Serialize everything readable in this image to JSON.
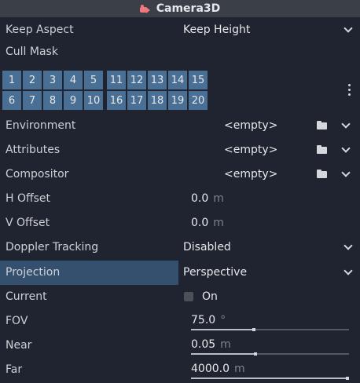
{
  "header": {
    "title": "Camera3D",
    "icon": "camera3d-icon"
  },
  "properties": {
    "keep_aspect": {
      "label": "Keep Aspect",
      "value": "Keep Height"
    },
    "cull_mask": {
      "label": "Cull Mask",
      "layers_row1": [
        "1",
        "2",
        "3",
        "4",
        "5",
        "11",
        "12",
        "13",
        "14",
        "15"
      ],
      "layers_row2": [
        "6",
        "7",
        "8",
        "9",
        "10",
        "16",
        "17",
        "18",
        "19",
        "20"
      ]
    },
    "environment": {
      "label": "Environment",
      "value": "<empty>"
    },
    "attributes": {
      "label": "Attributes",
      "value": "<empty>"
    },
    "compositor": {
      "label": "Compositor",
      "value": "<empty>"
    },
    "h_offset": {
      "label": "H Offset",
      "value": "0.0",
      "unit": "m"
    },
    "v_offset": {
      "label": "V Offset",
      "value": "0.0",
      "unit": "m"
    },
    "doppler_tracking": {
      "label": "Doppler Tracking",
      "value": "Disabled"
    },
    "projection": {
      "label": "Projection",
      "value": "Perspective"
    },
    "current": {
      "label": "Current",
      "checkbox_label": "On",
      "checked": false
    },
    "fov": {
      "label": "FOV",
      "value": "75.0",
      "unit": "°",
      "slider_fraction": 0.4
    },
    "near": {
      "label": "Near",
      "value": "0.05",
      "unit": "m",
      "slider_fraction": 0.41
    },
    "far": {
      "label": "Far",
      "value": "4000.0",
      "unit": "m",
      "slider_fraction": 1.0
    }
  },
  "colors": {
    "background": "#1f2430",
    "header_bg": "#3a3f48",
    "layer_button": "#4a6f95",
    "selected_row": "#35506e",
    "camera_icon": "#f0787c"
  }
}
